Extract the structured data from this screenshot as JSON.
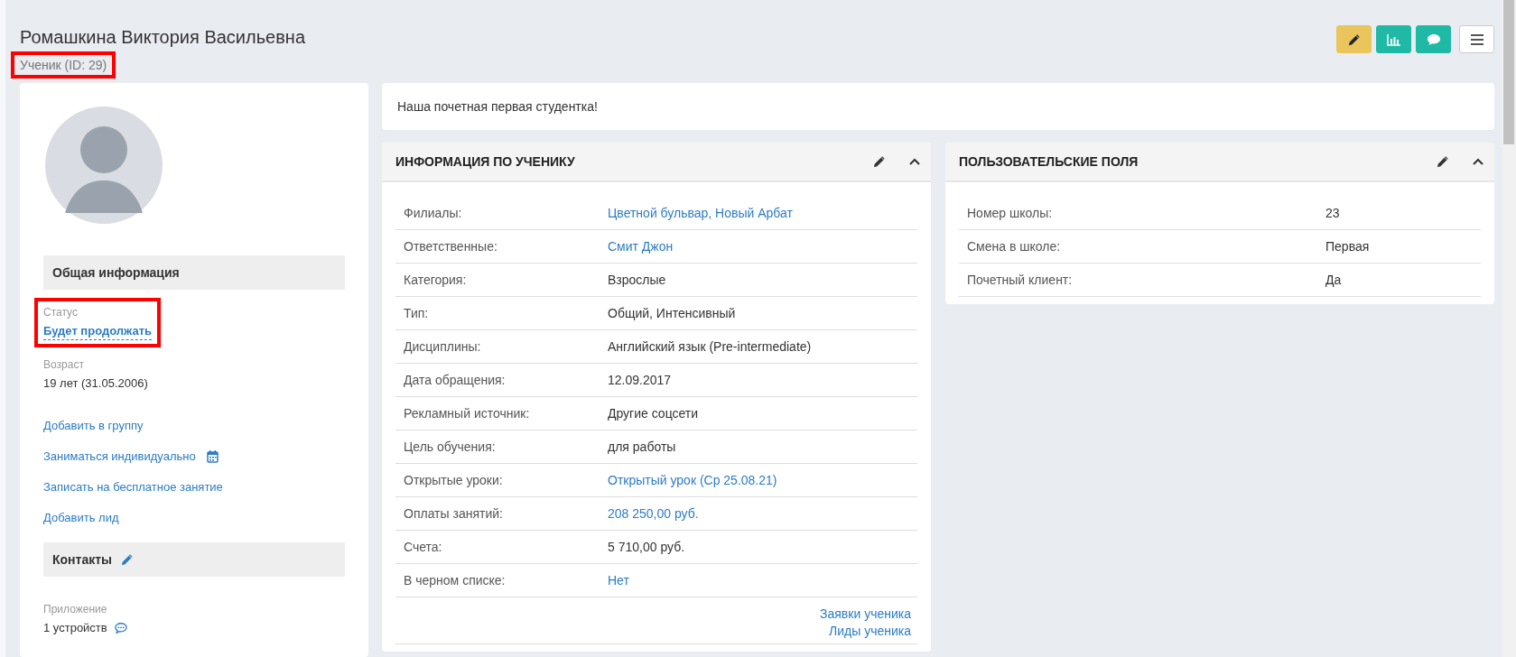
{
  "header": {
    "name": "Ромашкина Виктория Васильевна",
    "subtitle": "Ученик (ID: 29)",
    "subtitle_highlighted": true
  },
  "toolbar": [
    {
      "kind": "edit"
    },
    {
      "kind": "stats"
    },
    {
      "kind": "chat"
    },
    {
      "kind": "menu"
    }
  ],
  "general": {
    "title": "Общая информация",
    "fields": [
      {
        "label": "Статус",
        "value": "Будет продолжать",
        "kind": "status",
        "highlighted": true
      },
      {
        "label": "Возраст",
        "value": "19 лет (31.05.2006)",
        "kind": "text",
        "highlighted": false
      }
    ],
    "actions": [
      {
        "label": "Добавить в группу",
        "kind": "link"
      },
      {
        "label": "Заниматься индивидуально",
        "kind": "calendar"
      },
      {
        "label": "Записать на бесплатное занятие",
        "kind": "link"
      },
      {
        "label": "Добавить лид",
        "kind": "link"
      }
    ]
  },
  "contacts": {
    "title": "Контакты",
    "fields": [
      {
        "label": "Приложение",
        "value": "1 устройств",
        "kind": "chat"
      }
    ]
  },
  "note": "Наша почетная первая студентка!",
  "panels": [
    {
      "title": "ИНФОРМАЦИЯ ПО УЧЕНИКУ",
      "expanded": true,
      "rows": [
        {
          "label": "Филиалы:",
          "value": "Цветной бульвар, Новый Арбат",
          "kind": "link"
        },
        {
          "label": "Ответственные:",
          "value": "Смит Джон",
          "kind": "link"
        },
        {
          "label": "Категория:",
          "value": "Взрослые",
          "kind": "text"
        },
        {
          "label": "Тип:",
          "value": "Общий, Интенсивный",
          "kind": "text"
        },
        {
          "label": "Дисциплины:",
          "value": "Английский язык (Pre-intermediate)",
          "kind": "text"
        },
        {
          "label": "Дата обращения:",
          "value": "12.09.2017",
          "kind": "text"
        },
        {
          "label": "Рекламный источник:",
          "value": "Другие соцсети",
          "kind": "text"
        },
        {
          "label": "Цель обучения:",
          "value": "для работы",
          "kind": "text"
        },
        {
          "label": "Открытые уроки:",
          "value": "Открытый урок (Ср 25.08.21)",
          "kind": "link"
        },
        {
          "label": "Оплаты занятий:",
          "value": "208 250,00 руб.",
          "kind": "link"
        },
        {
          "label": "Счета:",
          "value": "5 710,00 руб.",
          "kind": "text"
        },
        {
          "label": "В черном списке:",
          "value": "Нет",
          "kind": "link"
        }
      ],
      "links": [
        "Заявки ученика",
        "Лиды ученика"
      ]
    },
    {
      "title": "ПОЛЬЗОВАТЕЛЬСКИЕ ПОЛЯ",
      "expanded": true,
      "rows": [
        {
          "label": "Номер школы:",
          "value": "23",
          "kind": "text"
        },
        {
          "label": "Смена в школе:",
          "value": "Первая",
          "kind": "text"
        },
        {
          "label": "Почетный клиент:",
          "value": "Да",
          "kind": "text"
        }
      ]
    }
  ]
}
